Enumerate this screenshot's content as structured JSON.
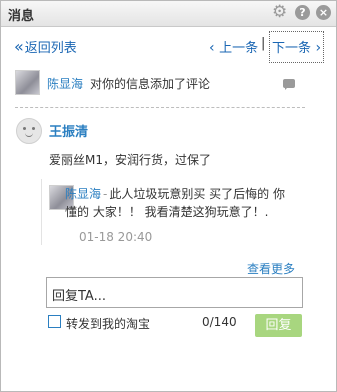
{
  "window": {
    "title": "消息"
  },
  "nav": {
    "back_label": "返回列表",
    "prev_label": "上一条",
    "separator": "|",
    "next_label": "下一条"
  },
  "notice": {
    "user_name": "陈显海",
    "text": "对你的信息添加了评论"
  },
  "post": {
    "author": "王振清",
    "text": "爱丽丝M1，安润行货，过保了"
  },
  "reply": {
    "user_name": "陈显海",
    "separator": "-",
    "text": "此人垃圾玩意别买 买了后悔的 你懂的 大家！！ 我看清楚这狗玩意了！.",
    "time": "01-18 20:40"
  },
  "more_label": "查看更多",
  "compose": {
    "placeholder": "回复TA...",
    "forward_label": "转发到我的淘宝",
    "forward_checked": false,
    "counter": "0/140",
    "submit_label": "回复"
  },
  "colors": {
    "link": "#1a66b3",
    "name": "#2b7fc1",
    "submit_bg": "#a8d67f",
    "muted": "#999999"
  }
}
